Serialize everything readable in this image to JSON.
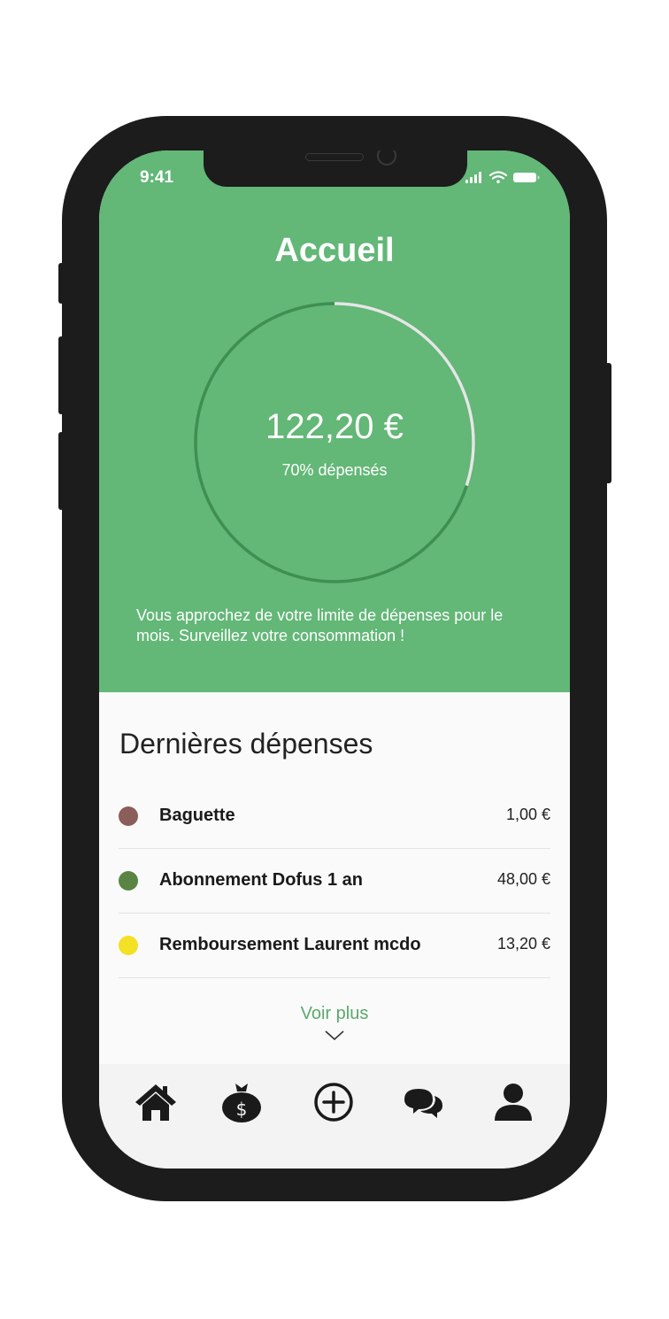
{
  "status_bar": {
    "time": "9:41"
  },
  "header": {
    "title": "Accueil"
  },
  "budget": {
    "amount": "122,20 €",
    "percent_label": "70% dépensés",
    "ring_progress": 0.3,
    "warning": "Vous approchez de votre limite de dépenses pour le mois. Surveillez votre consommation !"
  },
  "expenses": {
    "title": "Dernières dépenses",
    "items": [
      {
        "label": "Baguette",
        "amount": "1,00 €",
        "color": "#8b5e5a"
      },
      {
        "label": "Abonnement Dofus 1 an",
        "amount": "48,00 €",
        "color": "#5a8443"
      },
      {
        "label": "Remboursement Laurent mcdo",
        "amount": "13,20 €",
        "color": "#f4e025"
      }
    ],
    "see_more": "Voir plus"
  },
  "tabbar": {
    "items": [
      "home-icon",
      "money-bag-icon",
      "add-circle-icon",
      "chat-icon",
      "profile-icon"
    ]
  },
  "colors": {
    "primary": "#63b777",
    "ring_track": "#3f8e52",
    "ring_progress": "#e6e6e6"
  }
}
